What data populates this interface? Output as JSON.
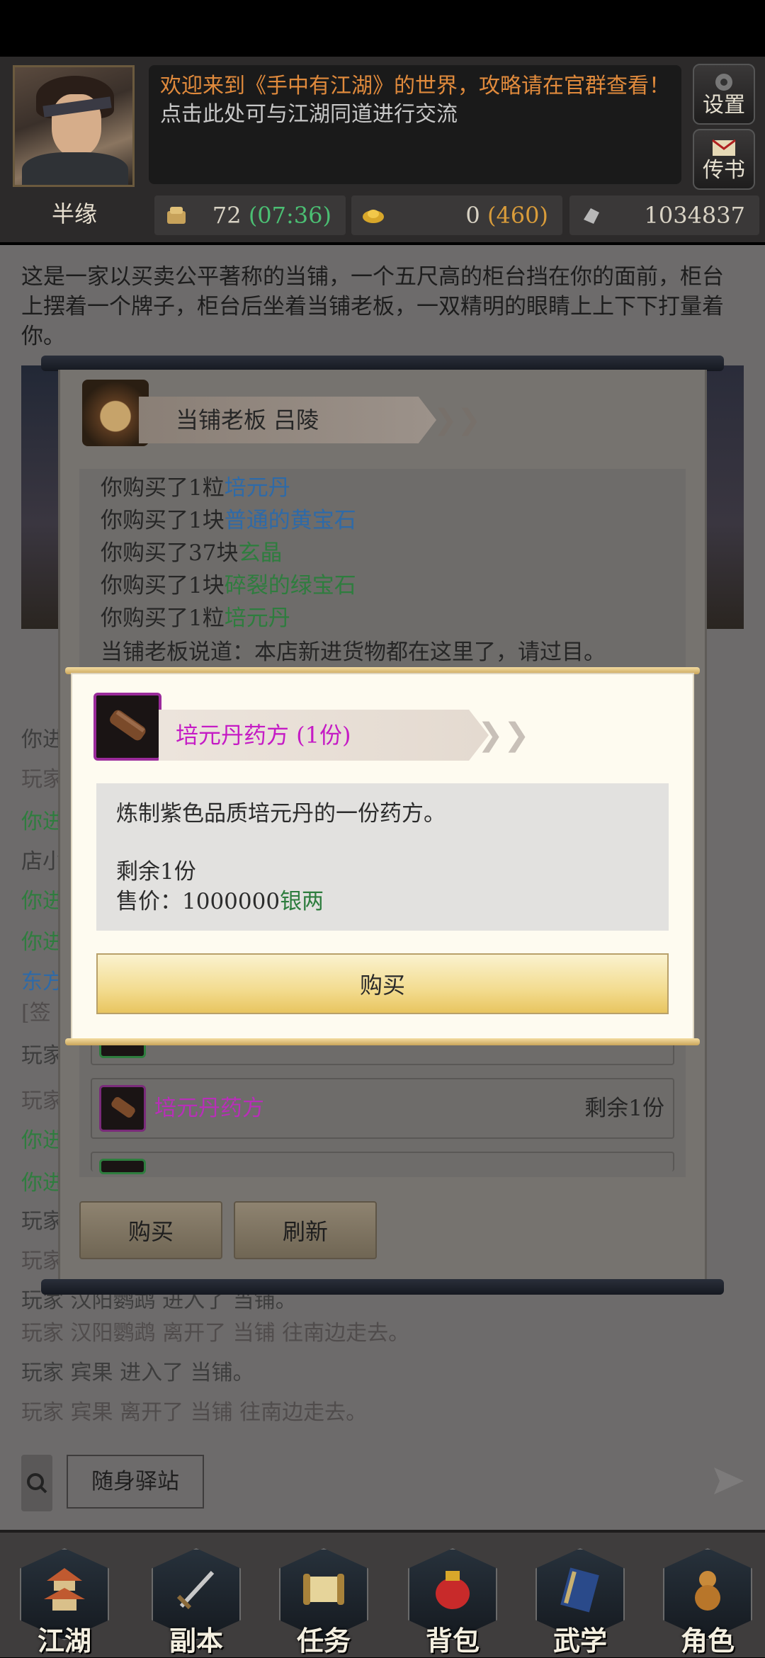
{
  "header": {
    "welcome_text": "欢迎来到《手中有江湖》的世界，攻略请在官群查看！",
    "chat_hint": "点击此处可与江湖同道进行交流",
    "settings_label": "设置",
    "mail_label": "传书",
    "player_name": "半缘"
  },
  "stats": {
    "energy_value": "72",
    "energy_timer": "(07:36)",
    "gold_value": "0",
    "gold_extra": "(460)",
    "silver_value": "1034837"
  },
  "description": "这是一家以买卖公平著称的当铺，一个五尺高的柜台挡在你的面前，柜台上摆着一个牌子，柜台后坐着当铺老板，一双精明的眼睛上上下下打量着你。",
  "shop": {
    "keeper_name": "当铺老板 吕陵",
    "log": [
      {
        "prefix": "你购买了1粒",
        "item": "培元丹",
        "color": "blue"
      },
      {
        "prefix": "你购买了1块",
        "item": "普通的黄宝石",
        "color": "blue"
      },
      {
        "prefix": "你购买了37块",
        "item": "玄晶",
        "color": "green"
      },
      {
        "prefix": "你购买了1块",
        "item": "碎裂的绿宝石",
        "color": "green"
      },
      {
        "prefix": "你购买了1粒",
        "item": "培元丹",
        "color": "green"
      }
    ],
    "keeper_says": "当铺老板说道：本店新进货物都在这里了，请过目。",
    "item_name": "培元丹药方",
    "item_remaining": "剩余1份",
    "buy_label": "购买",
    "refresh_label": "刷新"
  },
  "dialog": {
    "title": "培元丹药方 (1份)",
    "description": "炼制紫色品质培元丹的一份药方。",
    "remaining": "剩余1份",
    "price_label": "售价：",
    "price_value": "1000000",
    "price_unit": "银两",
    "buy_label": "购买"
  },
  "chat_log": {
    "left_fragments": [
      "你进",
      "玩家",
      "你进",
      "店小",
      "你进",
      "你进",
      "东方",
      "[签",
      "玩家",
      "玩家",
      "你进",
      "你进",
      "玩家",
      "玩家"
    ],
    "lines": [
      "玩家 汉阳鹦鹉 进入了 当铺。",
      "玩家 汉阳鹦鹉 离开了 当铺 往南边走去。",
      "玩家 宾果 进入了 当铺。",
      "玩家 宾果 离开了 当铺 往南边走去。"
    ]
  },
  "bottom": {
    "station_label": "随身驿站"
  },
  "nav": [
    {
      "label": "江湖",
      "icon": "pagoda-icon"
    },
    {
      "label": "副本",
      "icon": "sword-icon"
    },
    {
      "label": "任务",
      "icon": "scroll-icon"
    },
    {
      "label": "背包",
      "icon": "bag-icon"
    },
    {
      "label": "武学",
      "icon": "book-icon"
    },
    {
      "label": "角色",
      "icon": "gourd-icon"
    }
  ],
  "colors": {
    "welcome": "#e08a3c",
    "green": "#4bbf73",
    "orange": "#d99c3a",
    "magenta": "#c51bc5",
    "blue": "#2e6aa8"
  }
}
